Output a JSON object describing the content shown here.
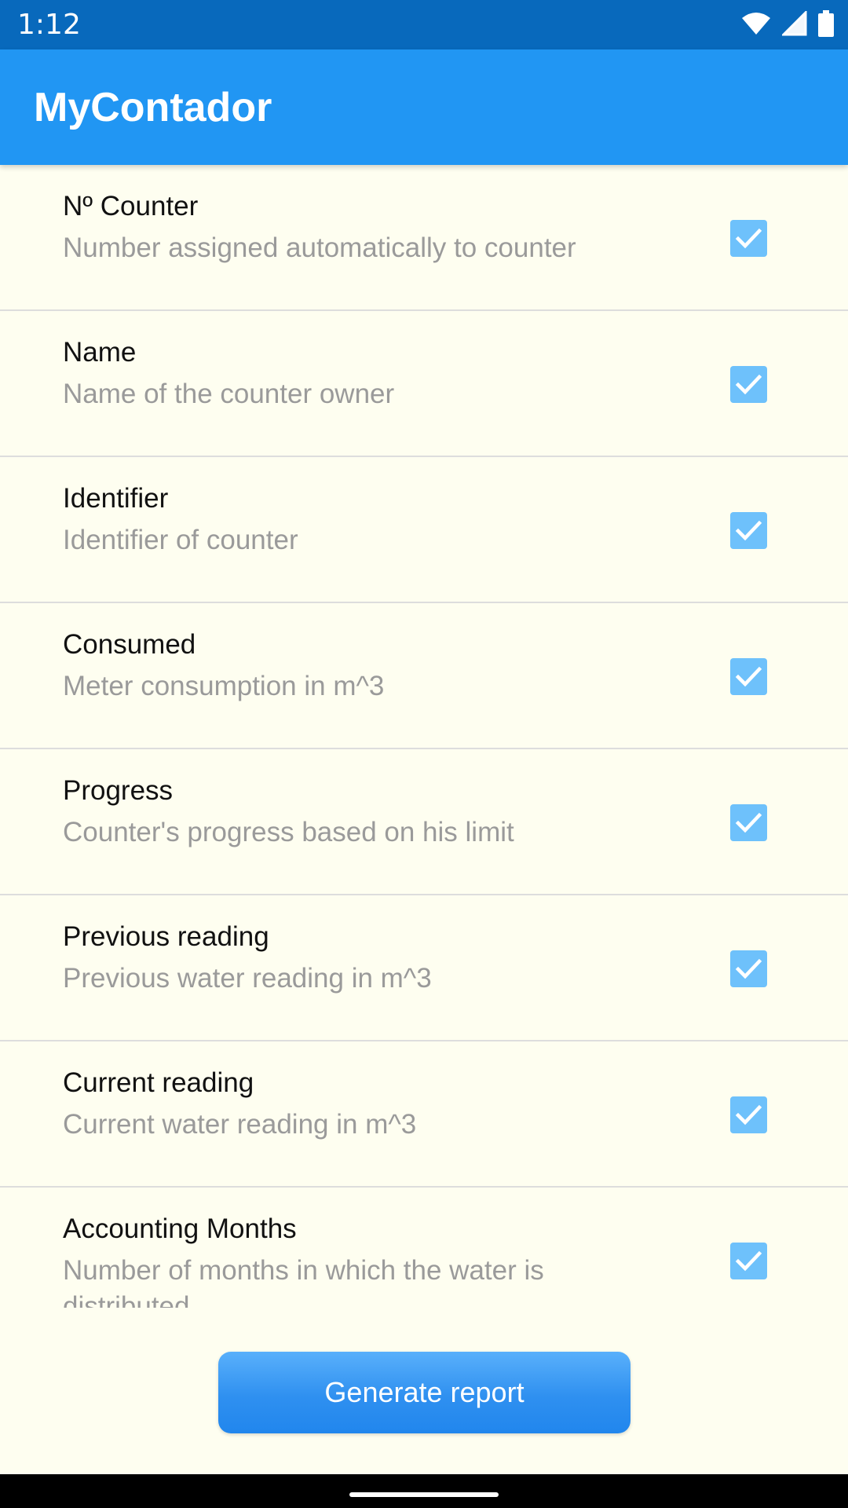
{
  "status_bar": {
    "time": "1:12",
    "icons": [
      "wifi-icon",
      "signal-icon",
      "battery-icon"
    ],
    "color": "#0869bc"
  },
  "app_bar": {
    "title": "MyContador",
    "color": "#2196f3"
  },
  "list": {
    "items": [
      {
        "title": "Nº Counter",
        "subtitle": "Number assigned automatically to counter",
        "checked": true
      },
      {
        "title": "Name",
        "subtitle": "Name of the counter owner",
        "checked": true
      },
      {
        "title": "Identifier",
        "subtitle": "Identifier of counter",
        "checked": true
      },
      {
        "title": "Consumed",
        "subtitle": "Meter consumption in m^3",
        "checked": true
      },
      {
        "title": "Progress",
        "subtitle": "Counter's progress based on his limit",
        "checked": true
      },
      {
        "title": "Previous reading",
        "subtitle": "Previous water reading in m^3",
        "checked": true
      },
      {
        "title": "Current reading",
        "subtitle": "Current water reading in m^3",
        "checked": true
      },
      {
        "title": "Accounting Months",
        "subtitle": "Number of months in which the water is distributed",
        "checked": true
      }
    ],
    "checkbox_color": "#6ec1fb"
  },
  "actions": {
    "generate_label": "Generate report",
    "button_color": "#2f90f0"
  }
}
